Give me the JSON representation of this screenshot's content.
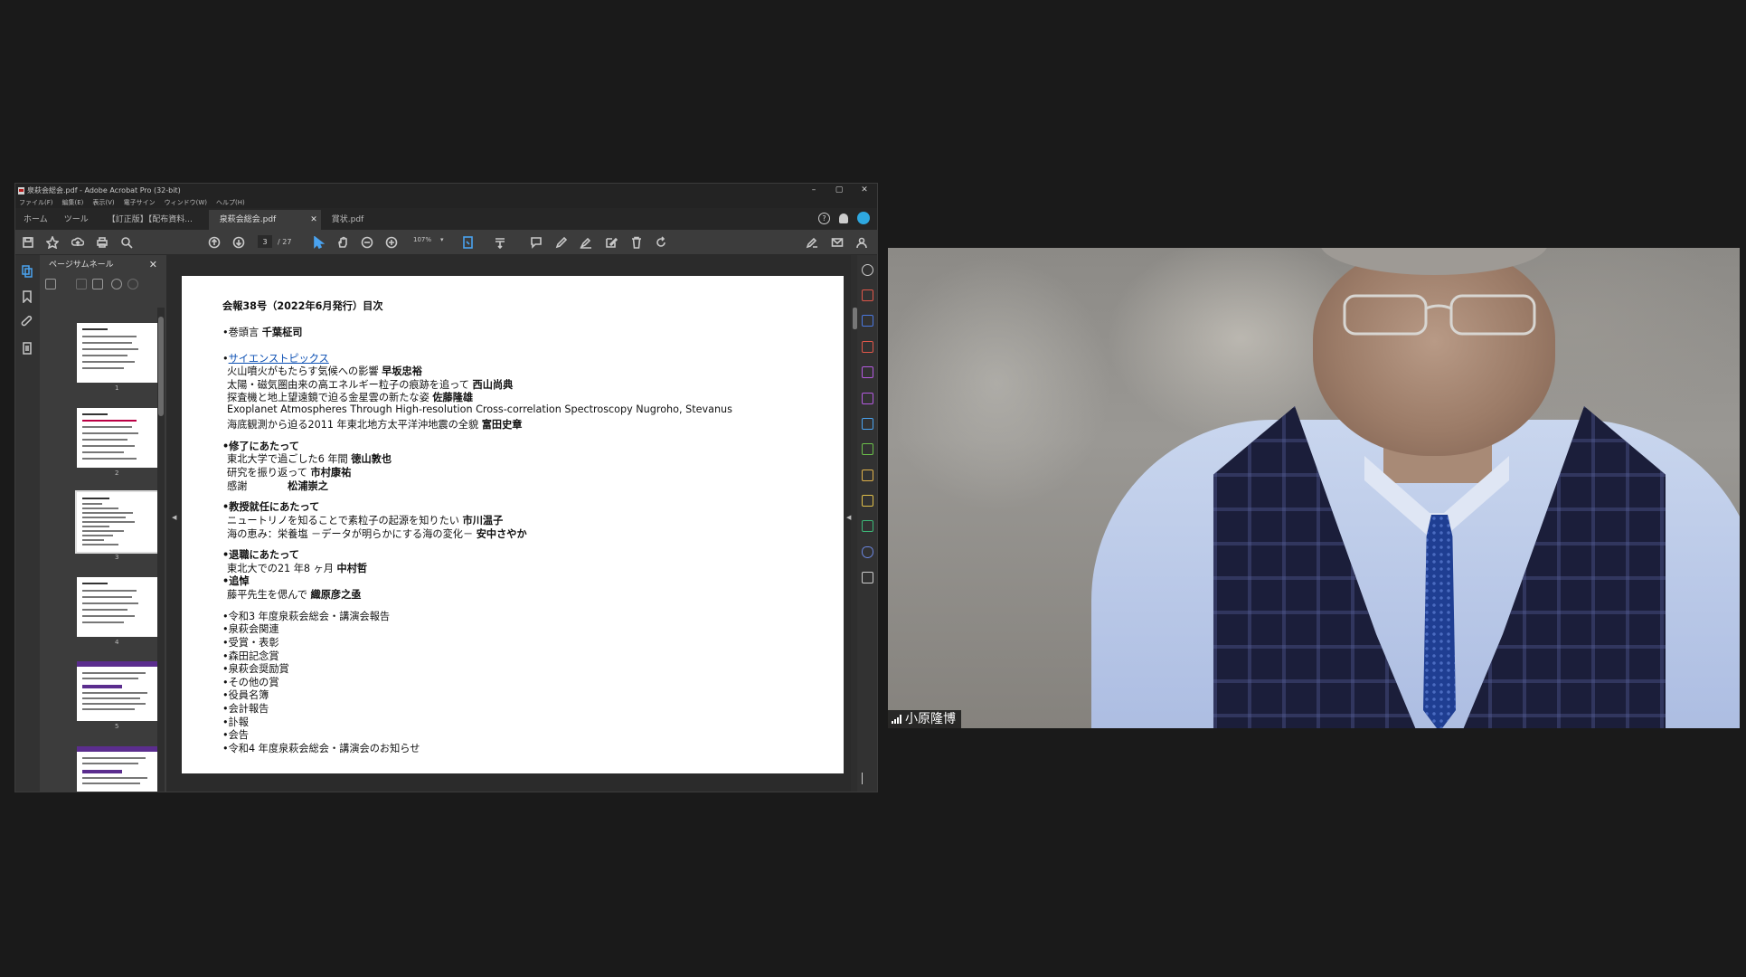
{
  "acrobat": {
    "title": "泉萩会総会.pdf - Adobe Acrobat Pro (32-bit)",
    "window_controls": [
      "–",
      "▢",
      "✕"
    ],
    "menu": [
      "ファイル(F)",
      "編集(E)",
      "表示(V)",
      "電子サイン",
      "ウィンドウ(W)",
      "ヘルプ(H)"
    ],
    "nav_tabs": [
      "ホーム",
      "ツール"
    ],
    "doc_tabs": [
      {
        "label": "【訂正版】【配布資料...",
        "active": false
      },
      {
        "label": "泉萩会総会.pdf",
        "active": true,
        "close": "✕"
      },
      {
        "label": "賞状.pdf",
        "active": false
      }
    ],
    "help_glyph": "?",
    "page_current": "3",
    "page_total": "/ 27",
    "zoom": "107%",
    "zoom_arrow": "▾",
    "thumbnails": {
      "title": "ページサムネール",
      "close": "✕",
      "pages": [
        "1",
        "2",
        "3",
        "4",
        "5"
      ]
    },
    "collapse_left": "◀",
    "collapse_right": "◀"
  },
  "pdf_page": {
    "heading": "会報38号（2022年6月発行）目次",
    "lines": [
      {
        "pre": "•巻頭言 ",
        "bold": "千葉柾司",
        "ind": false
      },
      {
        "link": "サイエンストピックス",
        "pre": "•",
        "ind": false
      },
      {
        "pre": "火山噴火がもたらす気候への影響 ",
        "bold": "早坂忠裕",
        "ind": true
      },
      {
        "pre": "太陽・磁気圏由来の高エネルギー粒子の痕跡を追って ",
        "bold": "西山尚典",
        "ind": true
      },
      {
        "pre": "探査機と地上望遠鏡で迫る金星雲の新たな姿 ",
        "bold": "佐藤隆雄",
        "ind": true
      },
      {
        "pre": "Exoplanet Atmospheres Through High-resolution Cross-correlation Spectroscopy  Nugroho, Stevanus",
        "bold": "",
        "ind": true
      },
      {
        "pre": "海底観測から迫る2011 年東北地方太平洋沖地震の全貌 ",
        "bold": "富田史章",
        "ind": true
      },
      {
        "pre": "",
        "bold": "•修了にあたって",
        "ind": false
      },
      {
        "pre": "東北大学で過ごした6 年間 ",
        "bold": "徳山敦也",
        "ind": true
      },
      {
        "pre": "研究を振り返って ",
        "bold": "市村康祐",
        "ind": true
      },
      {
        "pre": "感謝　　　　",
        "bold": "松浦崇之",
        "ind": true
      },
      {
        "pre": "",
        "bold": "•教授就任にあたって",
        "ind": false
      },
      {
        "pre": "ニュートリノを知ることで素粒子の起源を知りたい ",
        "bold": "市川温子",
        "ind": true
      },
      {
        "pre": "海の恵み：栄養塩 －データが明らかにする海の変化－ ",
        "bold": "安中さやか",
        "ind": true
      },
      {
        "pre": "",
        "bold": "•退職にあたって",
        "ind": false
      },
      {
        "pre": "東北大での21 年8 ヶ月 ",
        "bold": "中村哲",
        "ind": true
      },
      {
        "pre": "",
        "bold": "•追悼",
        "ind": false
      },
      {
        "pre": "藤平先生を偲んで ",
        "bold": "織原彦之亟",
        "ind": true
      },
      {
        "pre": "•令和3 年度泉萩会総会・講演会報告",
        "bold": "",
        "ind": false
      },
      {
        "pre": "•泉萩会関連",
        "bold": "",
        "ind": false
      },
      {
        "pre": "•受賞・表彰",
        "bold": "",
        "ind": false
      },
      {
        "pre": "•森田記念賞",
        "bold": "",
        "ind": false
      },
      {
        "pre": "•泉萩会奨励賞",
        "bold": "",
        "ind": false
      },
      {
        "pre": "•その他の賞",
        "bold": "",
        "ind": false
      },
      {
        "pre": "•役員名簿",
        "bold": "",
        "ind": false
      },
      {
        "pre": "•会計報告",
        "bold": "",
        "ind": false
      },
      {
        "pre": "•訃報",
        "bold": "",
        "ind": false
      },
      {
        "pre": "•会告",
        "bold": "",
        "ind": false
      },
      {
        "pre": "•令和4 年度泉萩会総会・講演会のお知らせ",
        "bold": "",
        "ind": false
      }
    ]
  },
  "video": {
    "participant_name": "小原隆博"
  },
  "colors": {
    "accent": "#4aa3f0",
    "link": "#0b4fb3",
    "thumb_band": "#5b2d8e"
  }
}
